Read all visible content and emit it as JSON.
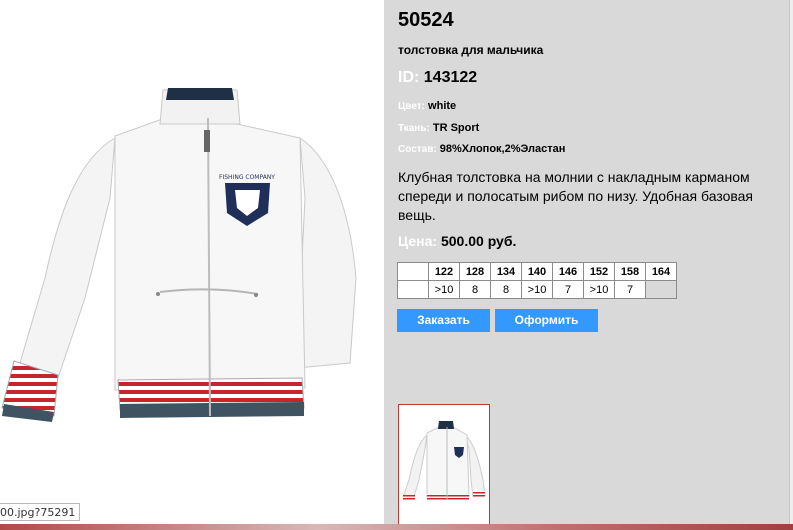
{
  "image_pane": {
    "status_tip": "00.jpg?75291"
  },
  "product": {
    "article": "50524",
    "subtitle": "толстовка для мальчика",
    "id_label": "ID:",
    "id_value": "143122",
    "color_label": "Цвет:",
    "color_value": "white",
    "fabric_label": "Ткань:",
    "fabric_value": "TR Sport",
    "composition_label": "Состав:",
    "composition_value": "98%Хлопок,2%Эластан",
    "description": "Клубная толстовка на молнии с накладным карманом спереди и полосатым рибом по низу. Удобная базовая вещь.",
    "price_label": "Цена:",
    "price_value": "500.00 руб."
  },
  "sizes": {
    "headers": [
      "122",
      "128",
      "134",
      "140",
      "146",
      "152",
      "158",
      "164"
    ],
    "stock": [
      ">10",
      "8",
      "8",
      ">10",
      "7",
      ">10",
      "7",
      ""
    ]
  },
  "buttons": {
    "order_label": "Заказать",
    "checkout_label": "Оформить"
  },
  "colors": {
    "panel_bg": "#d9d9d9",
    "button_bg": "#3399ff",
    "label_color": "#ffffff",
    "thumb_border": "#c0392b"
  }
}
